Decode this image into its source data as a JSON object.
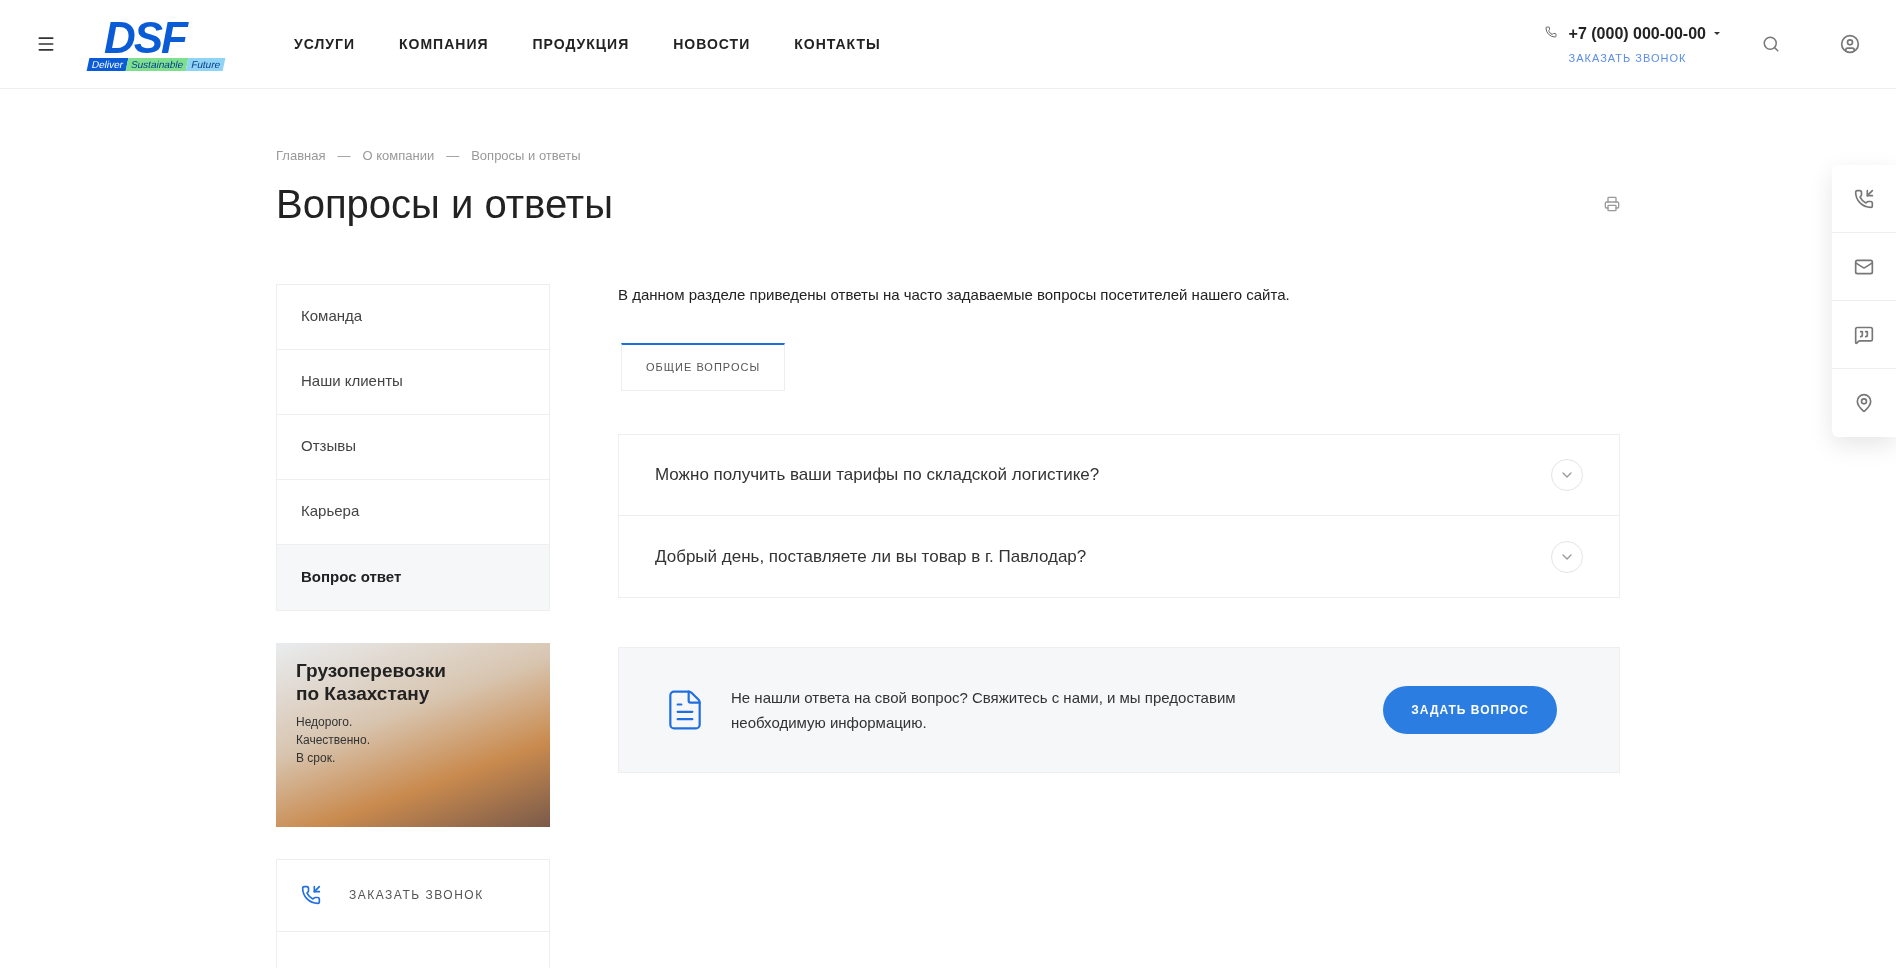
{
  "header": {
    "logo": {
      "mark": "DSF",
      "tagline": [
        "Deliver",
        "Sustainable",
        "Future"
      ]
    },
    "nav": [
      "УСЛУГИ",
      "КОМПАНИЯ",
      "ПРОДУКЦИЯ",
      "НОВОСТИ",
      "КОНТАКТЫ"
    ],
    "phone": "+7 (000) 000-00-00",
    "callback": "ЗАКАЗАТЬ ЗВОНОК"
  },
  "breadcrumbs": [
    "Главная",
    "О компании",
    "Вопросы и ответы"
  ],
  "breadcrumb_separator": "—",
  "title": "Вопросы и ответы",
  "sidebar": {
    "items": [
      {
        "label": "Команда",
        "selected": false
      },
      {
        "label": "Наши клиенты",
        "selected": false
      },
      {
        "label": "Отзывы",
        "selected": false
      },
      {
        "label": "Карьера",
        "selected": false
      },
      {
        "label": "Вопрос ответ",
        "selected": true
      }
    ],
    "banner": {
      "title": "Грузоперевозки по Казахстану",
      "lines": [
        "Недорого.",
        "Качественно.",
        "В срок."
      ]
    },
    "callback": "ЗАКАЗАТЬ ЗВОНОК"
  },
  "intro": "В данном разделе приведены ответы на часто задаваемые вопросы посетителей нашего сайта.",
  "tabs": [
    {
      "label": "ОБЩИЕ ВОПРОСЫ",
      "selected": true
    }
  ],
  "faq": [
    {
      "question": "Можно получить ваши тарифы по складской логистике?",
      "expanded": false
    },
    {
      "question": "Добрый день, поставляете ли вы товар в г. Павлодар?",
      "expanded": false
    }
  ],
  "callout": {
    "text": "Не нашли ответа на свой вопрос? Свяжитесь с нами, и мы предоставим необходимую информацию.",
    "button": "ЗАДАТЬ ВОПРОС"
  }
}
